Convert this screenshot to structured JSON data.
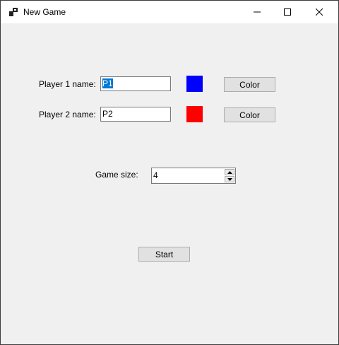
{
  "window": {
    "title": "New Game",
    "icon": "app-window-icon",
    "controls": [
      "minimize-icon",
      "maximize-icon",
      "close-icon"
    ]
  },
  "form": {
    "player1": {
      "label": "Player 1 name:",
      "value": "P1",
      "color": "#0000ff",
      "color_button": "Color"
    },
    "player2": {
      "label": "Player 2 name:",
      "value": "P2",
      "color": "#ff0000",
      "color_button": "Color"
    },
    "game_size": {
      "label": "Game size:",
      "value": "4"
    },
    "start_button": "Start"
  }
}
